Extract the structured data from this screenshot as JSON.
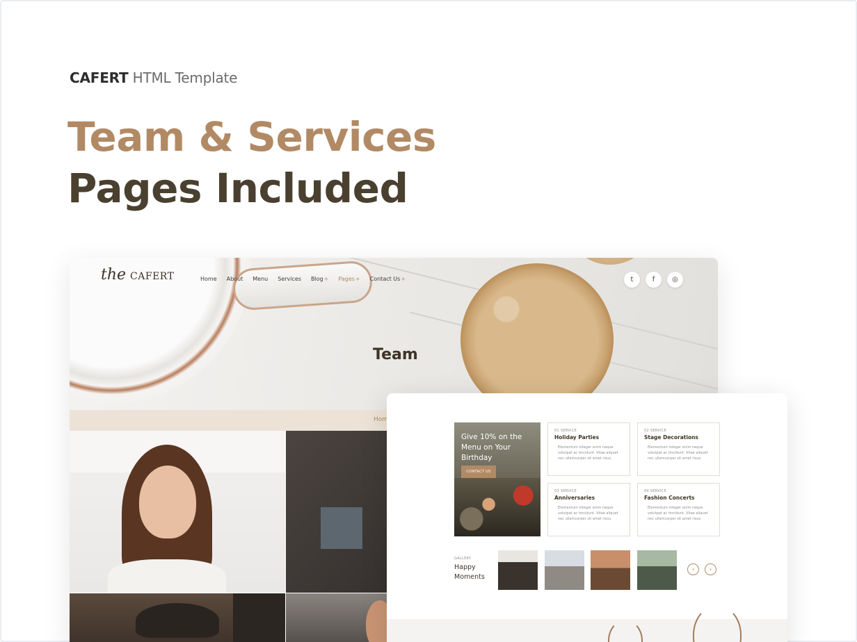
{
  "brand": {
    "name": "CAFERT",
    "suffix": "HTML Template"
  },
  "headline": {
    "line1": "Team & Services",
    "line2": "Pages Included"
  },
  "team_page": {
    "logo": {
      "the": "the",
      "name": "CAFERT"
    },
    "nav": [
      {
        "label": "Home",
        "has_plus": false,
        "active": false
      },
      {
        "label": "About",
        "has_plus": false,
        "active": false
      },
      {
        "label": "Menu",
        "has_plus": false,
        "active": false
      },
      {
        "label": "Services",
        "has_plus": false,
        "active": false
      },
      {
        "label": "Blog",
        "has_plus": true,
        "active": false
      },
      {
        "label": "Pages",
        "has_plus": true,
        "active": true
      },
      {
        "label": "Contact Us",
        "has_plus": true,
        "active": false
      }
    ],
    "plus_symbol": "+",
    "socials": [
      {
        "icon": "twitter-icon",
        "glyph": "t"
      },
      {
        "icon": "facebook-icon",
        "glyph": "f"
      },
      {
        "icon": "instagram-icon",
        "glyph": "◎"
      }
    ],
    "title": "Team",
    "breadcrumb": "Hom"
  },
  "services_page": {
    "promo": {
      "text": "Give 10% on the Menu on Your Birthday",
      "button": "CONTACT US"
    },
    "services": [
      {
        "num": "01 SERVICE",
        "name": "Holiday Parties",
        "desc": "Elementum integer enim neque volutpat ac tincidunt. Vitae aliquet nec ullamcorper sit amet risus."
      },
      {
        "num": "02 SERVICE",
        "name": "Stage Decorations",
        "desc": "Elementum integer enim neque volutpat ac tincidunt. Vitae aliquet nec ullamcorper sit amet risus."
      },
      {
        "num": "03 SERVICE",
        "name": "Anniversaries",
        "desc": "Elementum integer enim neque volutpat ac tincidunt. Vitae aliquet nec ullamcorper sit amet risus."
      },
      {
        "num": "04 SERVICE",
        "name": "Fashion Concerts",
        "desc": "Elementum integer enim neque volutpat ac tincidunt. Vitae aliquet nec ullamcorper sit amet risus."
      }
    ],
    "gallery": {
      "kicker": "GALLERY",
      "title": "Happy Moments",
      "prev": "‹",
      "next": "›"
    }
  },
  "colors": {
    "accent": "#b18a65",
    "dark": "#4a4030"
  }
}
